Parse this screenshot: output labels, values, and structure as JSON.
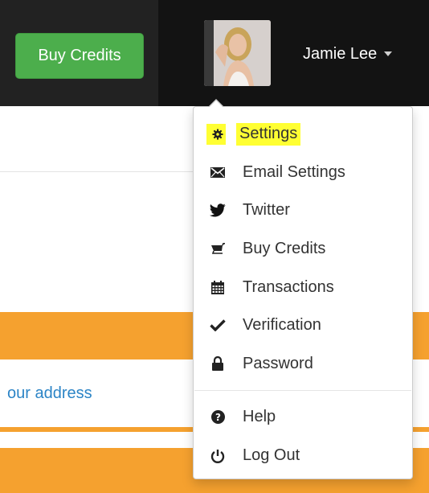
{
  "navbar": {
    "buy_credits_label": "Buy Credits",
    "user_name": "Jamie Lee"
  },
  "page": {
    "address_link": "our address"
  },
  "dropdown": {
    "items": [
      {
        "label": "Settings",
        "icon": "gear-icon",
        "highlighted": true
      },
      {
        "label": "Email Settings",
        "icon": "envelope-icon"
      },
      {
        "label": "Twitter",
        "icon": "twitter-icon"
      },
      {
        "label": "Buy Credits",
        "icon": "cart-icon"
      },
      {
        "label": "Transactions",
        "icon": "calendar-icon"
      },
      {
        "label": "Verification",
        "icon": "check-icon"
      },
      {
        "label": "Password",
        "icon": "lock-icon"
      }
    ],
    "footer_items": [
      {
        "label": "Help",
        "icon": "question-icon"
      },
      {
        "label": "Log Out",
        "icon": "power-icon"
      }
    ]
  },
  "colors": {
    "navbar_bg": "#1c1c1c",
    "buy_button": "#4cae4c",
    "highlight": "#ffff33",
    "orange_band": "#f5a12f",
    "link": "#2b84c6"
  }
}
